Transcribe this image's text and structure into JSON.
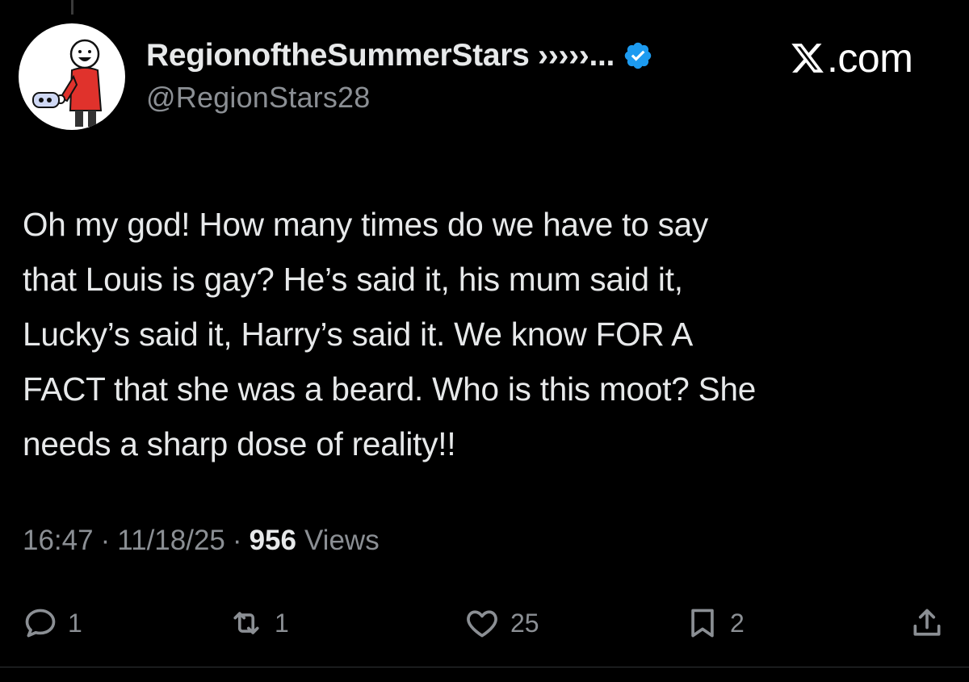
{
  "author": {
    "display_name": "RegionoftheSummerStars ›››››...",
    "handle": "@RegionStars28",
    "verified": true
  },
  "brand": {
    "site": ".com"
  },
  "tweet": {
    "text": "Oh my god! How many times do we have to say\nthat Louis is gay? He’s said it, his mum said it,\nLucky’s said it, Harry’s said it. We know FOR A\nFACT that she was a beard. Who is this moot? She\nneeds a sharp dose of reality!!"
  },
  "meta": {
    "time": "16:47",
    "separator": "·",
    "date": "11/18/25",
    "views_count": "956",
    "views_label": "Views"
  },
  "actions": {
    "replies": "1",
    "reposts": "1",
    "likes": "25",
    "bookmarks": "2"
  },
  "colors": {
    "background": "#000000",
    "text": "#e7e9ea",
    "muted": "#8b8f94",
    "verified": "#1d9bf0"
  },
  "icons": [
    "reply-icon",
    "repost-icon",
    "like-icon",
    "bookmark-icon",
    "share-icon",
    "verified-badge-icon",
    "x-logo-icon"
  ]
}
